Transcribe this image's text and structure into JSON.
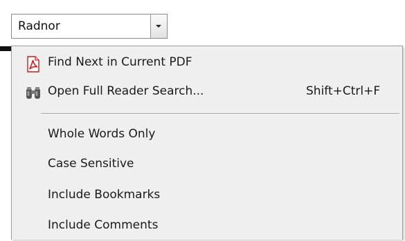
{
  "combo": {
    "value": "Radnor",
    "dropdown_icon": "chevron-down-icon"
  },
  "menu": {
    "items": [
      {
        "label": "Find Next in Current PDF",
        "shortcut": "",
        "icon": "pdf-icon"
      },
      {
        "label": "Open Full Reader Search...",
        "shortcut": "Shift+Ctrl+F",
        "icon": "binoculars-icon"
      },
      {
        "label": "Whole Words Only",
        "shortcut": ""
      },
      {
        "label": "Case Sensitive",
        "shortcut": ""
      },
      {
        "label": "Include Bookmarks",
        "shortcut": ""
      },
      {
        "label": "Include Comments",
        "shortcut": ""
      }
    ]
  },
  "colors": {
    "menu_background": "#efefef",
    "pdf_icon_red": "#d21b1b"
  }
}
